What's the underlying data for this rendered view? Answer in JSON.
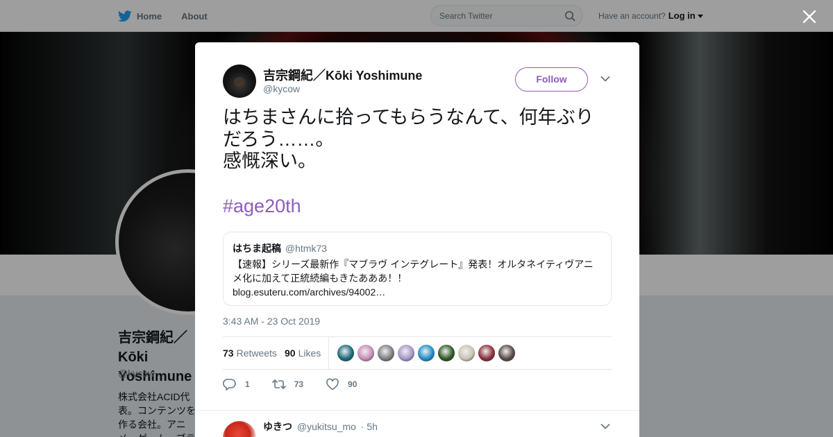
{
  "nav": {
    "home": "Home",
    "about": "About",
    "search_placeholder": "Search Twitter",
    "have_account": "Have an account?",
    "login": "Log in"
  },
  "profile_bg": {
    "name": "吉宗鋼紀／Kōki Yoshimune",
    "handle": "@kycow",
    "bio": "株式会社ACID代表。コンテンツを作る会社。アニメ・ゲーム・ブランドで企画広報・シナリオ等を中心に"
  },
  "tweet": {
    "author_name": "吉宗鋼紀／Kōki Yoshimune",
    "author_handle": "@kycow",
    "follow_label": "Follow",
    "text": "はちまさんに拾ってもらうなんて、何年ぶりだろう……。\n感慨深い。",
    "hashtag": "#age20th",
    "quote": {
      "name": "はちま起稿",
      "handle": "@htmk73",
      "text": "【速報】シリーズ最新作『マブラヴ インテグレート』発表！オルタネイティヴアニメ化に加えて正統続編もきたあああ！！",
      "link": "blog.esuteru.com/archives/94002…"
    },
    "timestamp": "3:43 AM - 23 Oct 2019",
    "retweets_count": "73",
    "retweets_label": "Retweets",
    "likes_count": "90",
    "likes_label": "Likes",
    "actions": {
      "replies": "1",
      "retweets": "73",
      "likes": "90"
    }
  },
  "reply": {
    "name": "ゆきつ",
    "handle": "@yukitsu_mo",
    "time": "· 5h"
  },
  "colors": {
    "accent": "#8e5ac0",
    "twitter_blue": "#1da1f2",
    "muted": "#657786"
  },
  "likers": [
    "#1a6b7a",
    "#c98bb8",
    "#7d7e84",
    "#a895c9",
    "#1c8fc9",
    "#2f5a22",
    "#c9c4b3",
    "#8a2f3a",
    "#5b4a44"
  ]
}
